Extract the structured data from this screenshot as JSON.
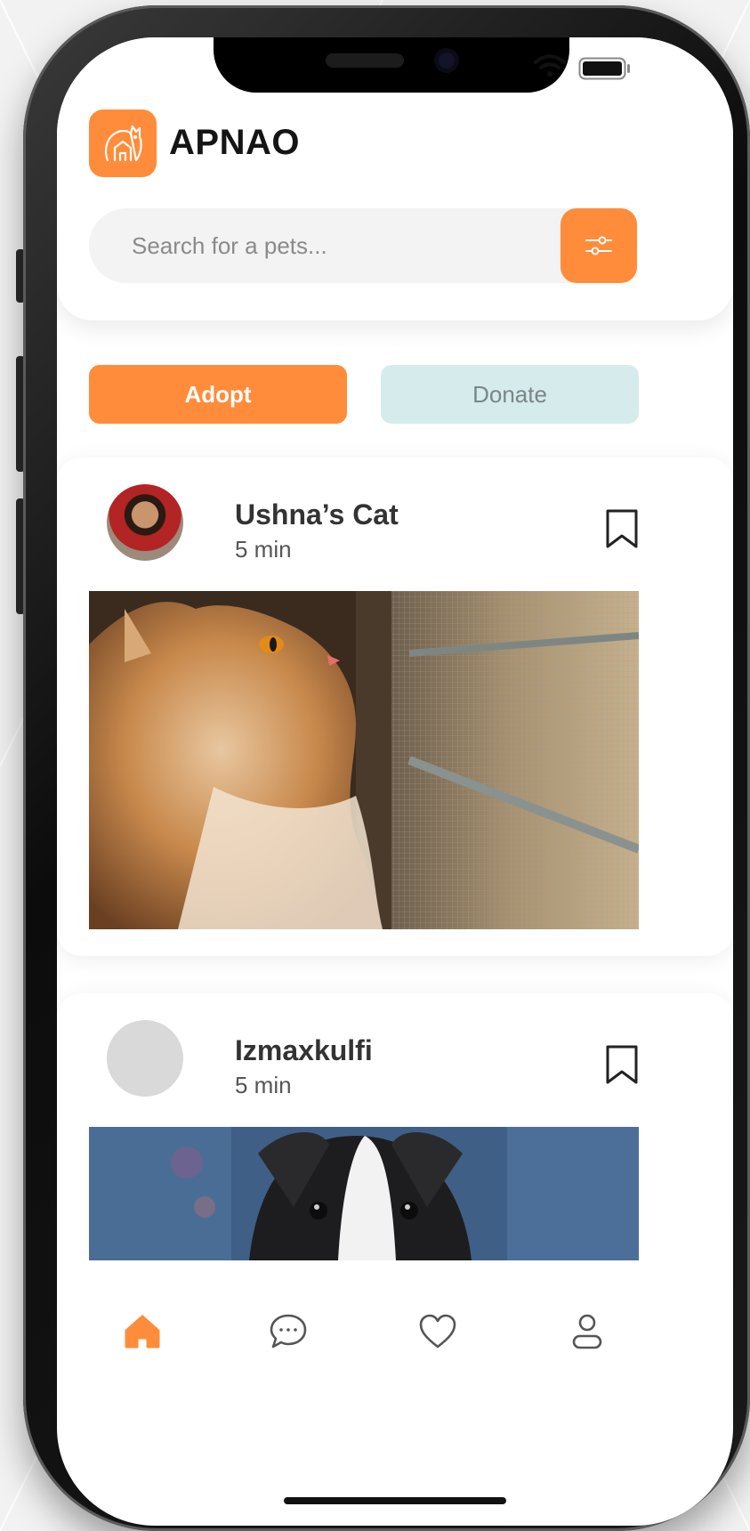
{
  "app": {
    "title": "APNAO",
    "logo_icon": "cat-house-icon"
  },
  "search": {
    "placeholder": "Search for a pets...",
    "filter_icon": "sliders-icon"
  },
  "actions": {
    "adopt_label": "Adopt",
    "donate_label": "Donate"
  },
  "posts": [
    {
      "name": "Ushna’s Cat",
      "time": "5 min",
      "bookmark_icon": "bookmark-icon",
      "photo": "orange-cat-at-window"
    },
    {
      "name": "Izmaxkulfi",
      "time": "5 min",
      "bookmark_icon": "bookmark-icon",
      "photo": "black-white-puppy"
    }
  ],
  "tabs": [
    {
      "id": "home",
      "icon": "home-icon",
      "active": true
    },
    {
      "id": "chat",
      "icon": "chat-icon",
      "active": false
    },
    {
      "id": "favorites",
      "icon": "heart-icon",
      "active": false
    },
    {
      "id": "profile",
      "icon": "profile-icon",
      "active": false
    }
  ],
  "colors": {
    "accent": "#ff8c3a",
    "donate_bg": "#d6ecec",
    "text_dark": "#151515",
    "muted": "#8a8a8a",
    "inactive_icon": "#555555"
  },
  "status": {
    "wifi_icon": "wifi-icon",
    "battery_icon": "battery-icon"
  }
}
